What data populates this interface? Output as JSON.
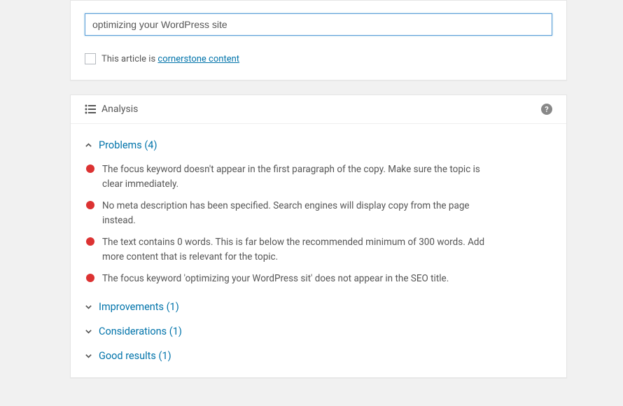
{
  "keyword_input": {
    "value": "optimizing your WordPress site"
  },
  "cornerstone": {
    "prefix": "This article is ",
    "link_text": "cornerstone content"
  },
  "analysis": {
    "title": "Analysis"
  },
  "sections": {
    "problems": {
      "label": "Problems (4)",
      "items": [
        "The focus keyword doesn't appear in the first paragraph of the copy. Make sure the topic is clear immediately.",
        "No meta description has been specified. Search engines will display copy from the page instead.",
        "The text contains 0 words. This is far below the recommended minimum of 300 words. Add more content that is relevant for the topic.",
        "The focus keyword 'optimizing your WordPress sit' does not appear in the SEO title."
      ]
    },
    "improvements": {
      "label": "Improvements (1)"
    },
    "considerations": {
      "label": "Considerations (1)"
    },
    "good_results": {
      "label": "Good results (1)"
    }
  }
}
